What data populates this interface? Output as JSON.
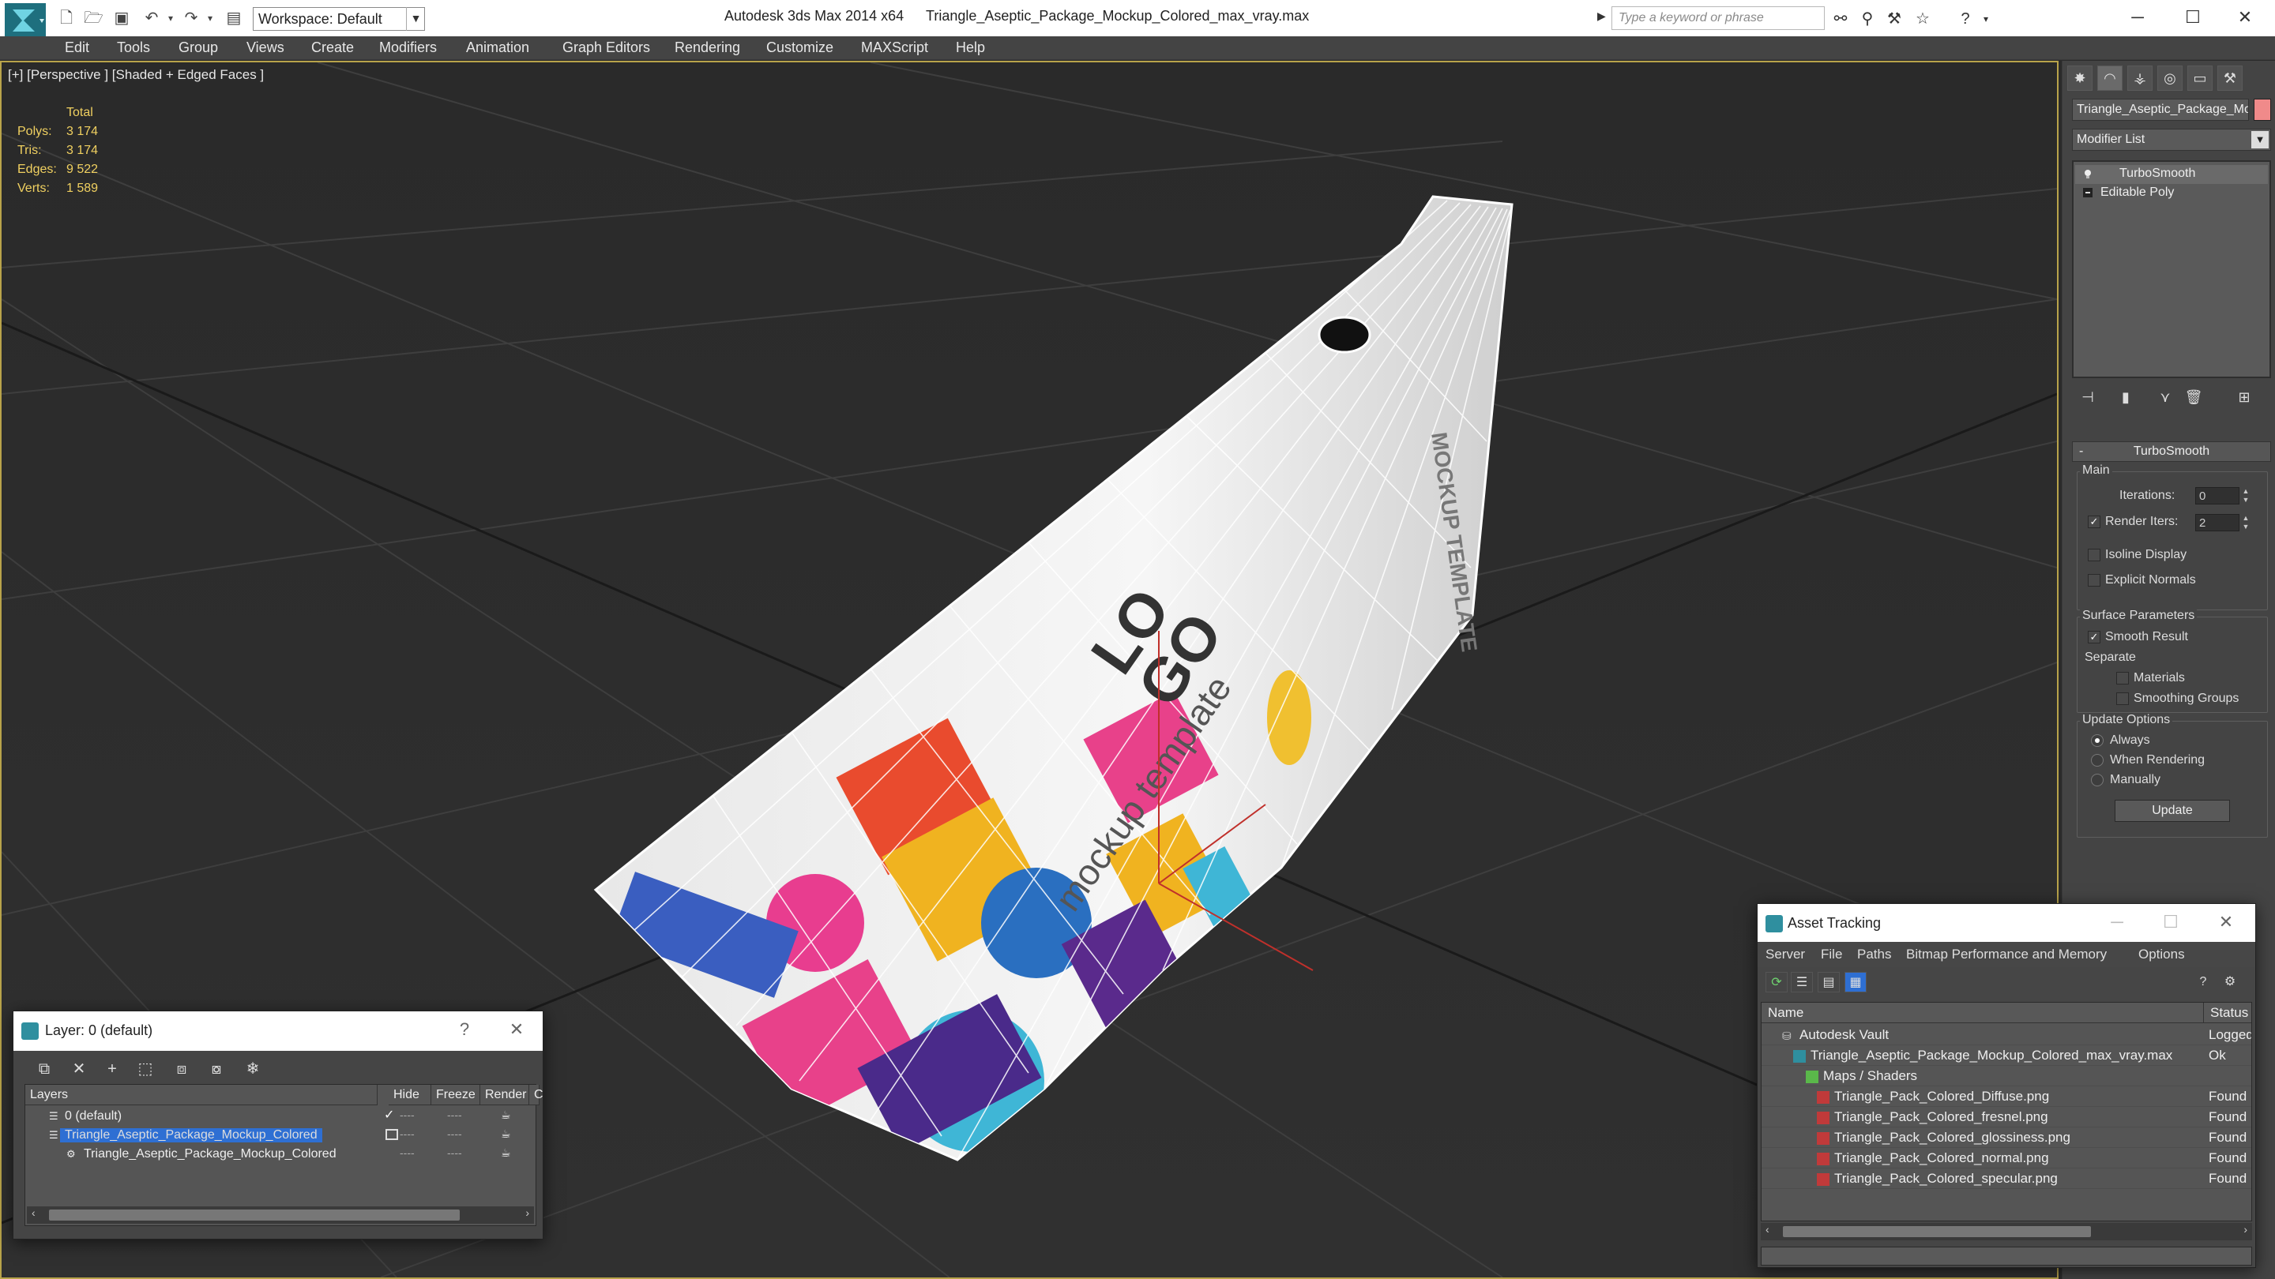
{
  "titlebar": {
    "app_title": "Autodesk 3ds Max  2014 x64",
    "file_title": "Triangle_Aseptic_Package_Mockup_Colored_max_vray.max",
    "workspace": "Workspace: Default",
    "search_placeholder": "Type a keyword or phrase"
  },
  "menu": [
    "Edit",
    "Tools",
    "Group",
    "Views",
    "Create",
    "Modifiers",
    "Animation",
    "Graph Editors",
    "Rendering",
    "Customize",
    "MAXScript",
    "Help"
  ],
  "viewport": {
    "label": "[+] [Perspective ] [Shaded + Edged Faces ]",
    "stats": {
      "header": "Total",
      "rows": [
        {
          "label": "Polys:",
          "value": "3 174"
        },
        {
          "label": "Tris:",
          "value": "3 174"
        },
        {
          "label": "Edges:",
          "value": "9 522"
        },
        {
          "label": "Verts:",
          "value": "1 589"
        }
      ]
    },
    "package_text": {
      "logo_1": "LO",
      "logo_2": "GO",
      "tagline": "mockup template",
      "side_text": "MOCKUP TEMPLATE"
    }
  },
  "command_panel": {
    "object_name": "Triangle_Aseptic_Package_Mockup",
    "object_color": "#f08a8a",
    "modifier_list": "Modifier List",
    "stack": [
      "TurboSmooth",
      "Editable Poly"
    ],
    "rollout_title": "TurboSmooth",
    "main_group": "Main",
    "iterations_label": "Iterations:",
    "iterations_value": "0",
    "render_iters_label": "Render Iters:",
    "render_iters_value": "2",
    "render_iters_checked": true,
    "isoline_label": "Isoline Display",
    "explicit_normals_label": "Explicit Normals",
    "surface_group": "Surface Parameters",
    "smooth_result_label": "Smooth Result",
    "smooth_result_checked": true,
    "separate_label": "Separate",
    "materials_label": "Materials",
    "smoothing_groups_label": "Smoothing Groups",
    "update_group": "Update Options",
    "update_options": [
      "Always",
      "When Rendering",
      "Manually"
    ],
    "update_selected": "Always",
    "update_button": "Update"
  },
  "layer_dialog": {
    "title": "Layer: 0 (default)",
    "help": "?",
    "columns": [
      "Layers",
      "Hide",
      "Freeze",
      "Render",
      "C"
    ],
    "rows": [
      {
        "name": "0 (default)",
        "selected": false,
        "indent": 1
      },
      {
        "name": "Triangle_Aseptic_Package_Mockup_Colored",
        "selected": true,
        "indent": 1
      },
      {
        "name": "Triangle_Aseptic_Package_Mockup_Colored",
        "selected": false,
        "indent": 2
      }
    ]
  },
  "asset_dialog": {
    "title": "Asset Tracking",
    "menu": [
      "Server",
      "File",
      "Paths",
      "Bitmap Performance and Memory",
      "Options"
    ],
    "columns": [
      "Name",
      "Status"
    ],
    "rows": [
      {
        "name": "Autodesk Vault",
        "status": "Logged",
        "indent": 1,
        "icon": "vault-icon"
      },
      {
        "name": "Triangle_Aseptic_Package_Mockup_Colored_max_vray.max",
        "status": "Ok",
        "indent": 2,
        "icon": "max-file-icon"
      },
      {
        "name": "Maps / Shaders",
        "status": "",
        "indent": 3,
        "icon": "maps-icon"
      },
      {
        "name": "Triangle_Pack_Colored_Diffuse.png",
        "status": "Found",
        "indent": 4,
        "icon": "png-icon"
      },
      {
        "name": "Triangle_Pack_Colored_fresnel.png",
        "status": "Found",
        "indent": 4,
        "icon": "png-icon"
      },
      {
        "name": "Triangle_Pack_Colored_glossiness.png",
        "status": "Found",
        "indent": 4,
        "icon": "png-icon"
      },
      {
        "name": "Triangle_Pack_Colored_normal.png",
        "status": "Found",
        "indent": 4,
        "icon": "png-icon"
      },
      {
        "name": "Triangle_Pack_Colored_specular.png",
        "status": "Found",
        "indent": 4,
        "icon": "png-icon"
      }
    ]
  },
  "colors": {
    "accent_selection": "#2e6fd3",
    "stats_text": "#f0d060",
    "viewport_border": "#b8a34a"
  }
}
